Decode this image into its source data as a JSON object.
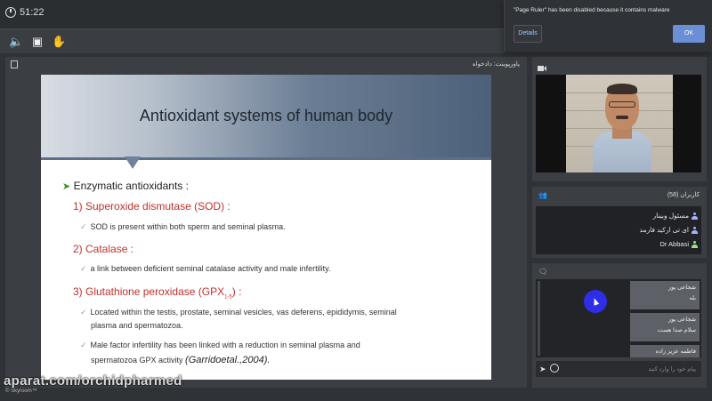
{
  "topbar": {
    "timer": "51:22"
  },
  "notification": {
    "message": "\"Page Ruler\" has been disabled because it contains malware",
    "details_label": "Details",
    "ok_label": "OK"
  },
  "main_panel": {
    "title": "پاورپوینت: دادخواه"
  },
  "slide": {
    "title": "Antioxidant systems of human body",
    "section_heading": "Enzymatic antioxidants :",
    "items": [
      {
        "heading": "1) Superoxide dismutase (SOD) :",
        "points": [
          "SOD is present within both sperm and seminal plasma."
        ]
      },
      {
        "heading": "2) Catalase :",
        "points": [
          "a link between deficient seminal catalase activity and male infertility."
        ]
      },
      {
        "heading": "3) Glutathione peroxidase (GPX",
        "heading_sub": "1-5",
        "heading_end": ") :",
        "points": [
          "Located within the testis, prostate, seminal vesicles, vas deferens, epididymis, seminal",
          "plasma and spermatozoa.",
          "Male factor infertility has been linked with a reduction in seminal plasma and",
          "spermatozoa GPX activity "
        ],
        "citation": "(Garridoetal.,2004)."
      }
    ]
  },
  "users_panel": {
    "title": "کاربران (58)",
    "users": [
      {
        "name": "مسئول وبینار",
        "color": "#9fb6ff"
      },
      {
        "name": "ای تی ارکید فارمد",
        "color": "#9fb6ff"
      },
      {
        "name": "Dr Abbasi",
        "color": "#9be08a"
      }
    ]
  },
  "chat": {
    "messages": [
      {
        "sender": "شجاعی پور",
        "text": "بله"
      },
      {
        "sender": "شجاعی پور",
        "text": "سلام صدا هست"
      },
      {
        "sender": "فاطمه عزیز زاده",
        "text": ""
      }
    ],
    "input_placeholder": "پیام خود را وارد کنید"
  },
  "footer": {
    "brand": "© Skyroom™"
  },
  "watermark": "aparat.com/orchidpharmed"
}
